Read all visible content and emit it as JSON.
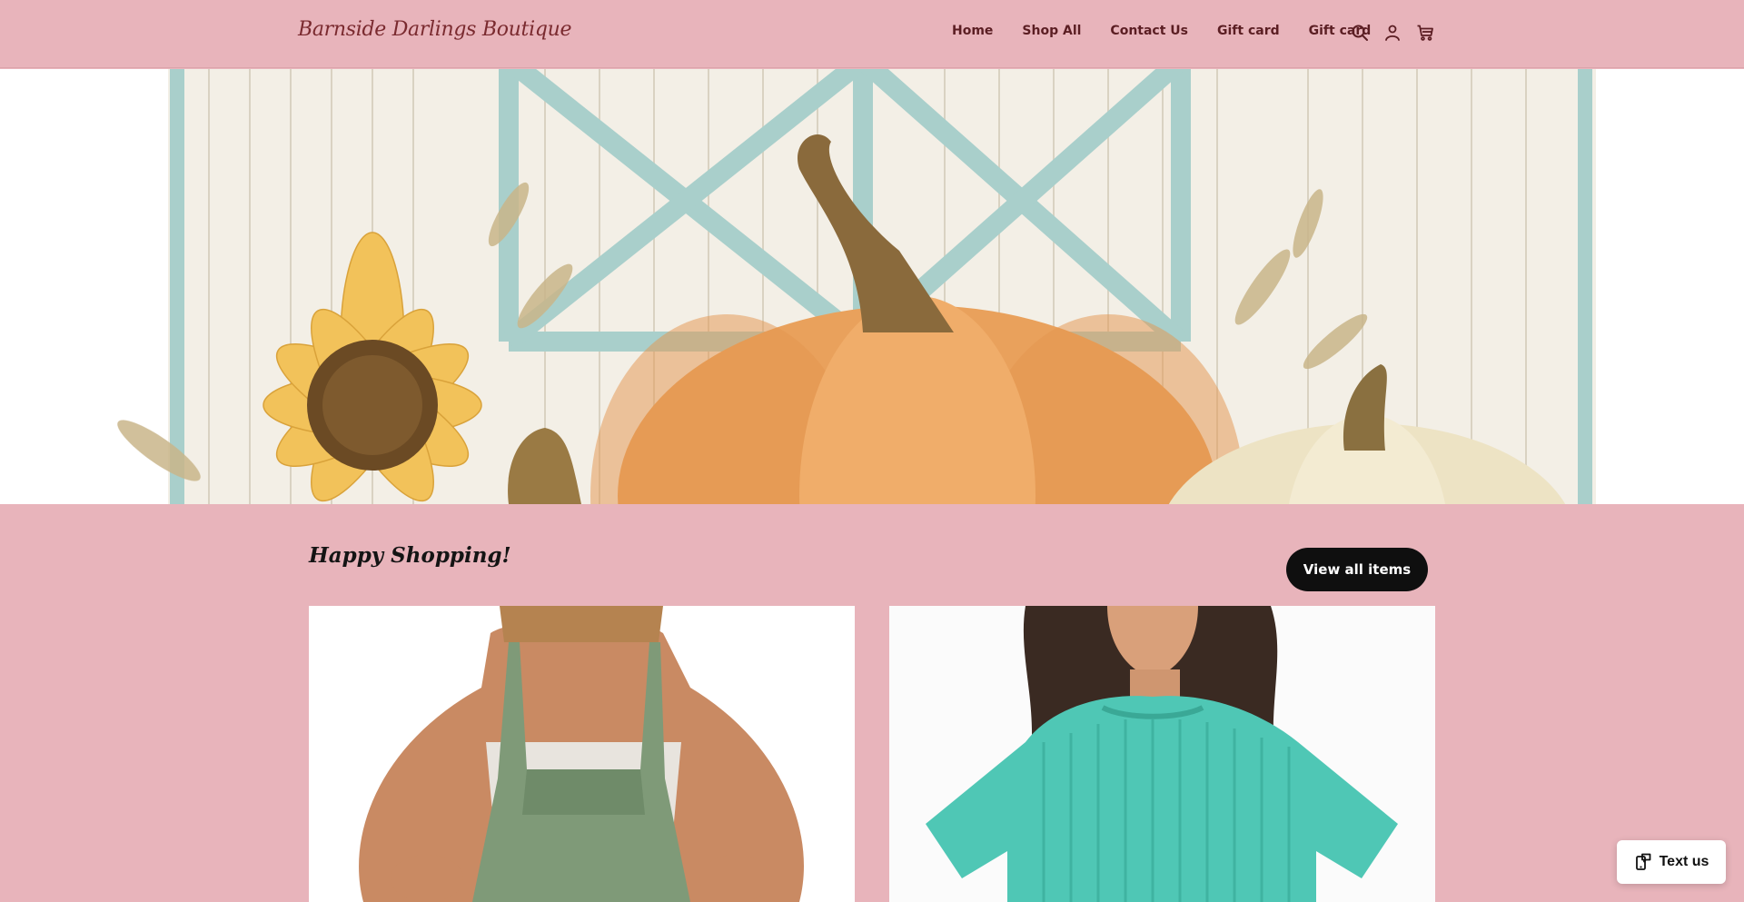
{
  "header": {
    "brand": "Barnside Darlings Boutique",
    "nav": [
      {
        "label": "Home"
      },
      {
        "label": "Shop All"
      },
      {
        "label": "Contact Us"
      },
      {
        "label": "Gift card"
      },
      {
        "label": "Gift card"
      }
    ],
    "icons": [
      "search-icon",
      "account-icon",
      "cart-icon"
    ]
  },
  "hero": {
    "image": "watercolor-barn-door-pumpkins-sunflower"
  },
  "collection": {
    "title": "Happy Shopping!",
    "view_all_label": "View all items",
    "products": [
      {
        "image": "green-gauze-overall-jumper"
      },
      {
        "image": "teal-ribbed-short-sleeve-top"
      }
    ]
  },
  "chat_widget": {
    "label": "Text us",
    "icon": "phone-message-icon"
  },
  "colors": {
    "background": "#e8b4bb",
    "brand": "#7a2a2f",
    "nav_text": "#5b1e23",
    "button": "#0f0f0f"
  }
}
